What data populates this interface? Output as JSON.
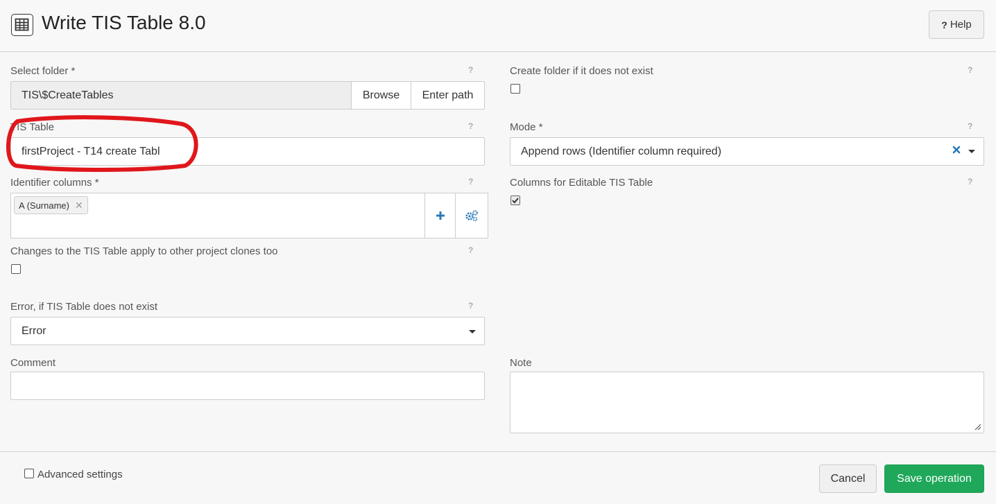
{
  "header": {
    "title": "Write TIS Table 8.0",
    "icon": "table-icon",
    "help_mark": "?",
    "help_label": "Help"
  },
  "help_mark": "?",
  "select_folder": {
    "label": "Select folder *",
    "value": "TIS\\$CreateTables",
    "browse_label": "Browse",
    "enter_path_label": "Enter path"
  },
  "create_folder": {
    "label": "Create folder if it does not exist",
    "checked": false
  },
  "tis_table": {
    "label": "TIS Table",
    "value": "firstProject - T14 create Tabl"
  },
  "mode": {
    "label": "Mode *",
    "value": "Append rows (Identifier column required)"
  },
  "identifier_columns": {
    "label": "Identifier columns *",
    "tags": [
      "A (Surname)"
    ]
  },
  "editable_columns": {
    "label": "Columns for Editable TIS Table",
    "checked": true
  },
  "clone_changes": {
    "label": "Changes to the TIS Table apply to other project clones too",
    "checked": false
  },
  "error_if_missing": {
    "label": "Error, if TIS Table does not exist",
    "value": "Error"
  },
  "comment": {
    "label": "Comment",
    "value": ""
  },
  "note": {
    "label": "Note",
    "value": ""
  },
  "footer": {
    "advanced_label": "Advanced settings",
    "cancel_label": "Cancel",
    "save_label": "Save operation"
  },
  "colors": {
    "accent_blue": "#2a7ab8",
    "save_green": "#1fa85a",
    "annotation_red": "#e0161b"
  }
}
